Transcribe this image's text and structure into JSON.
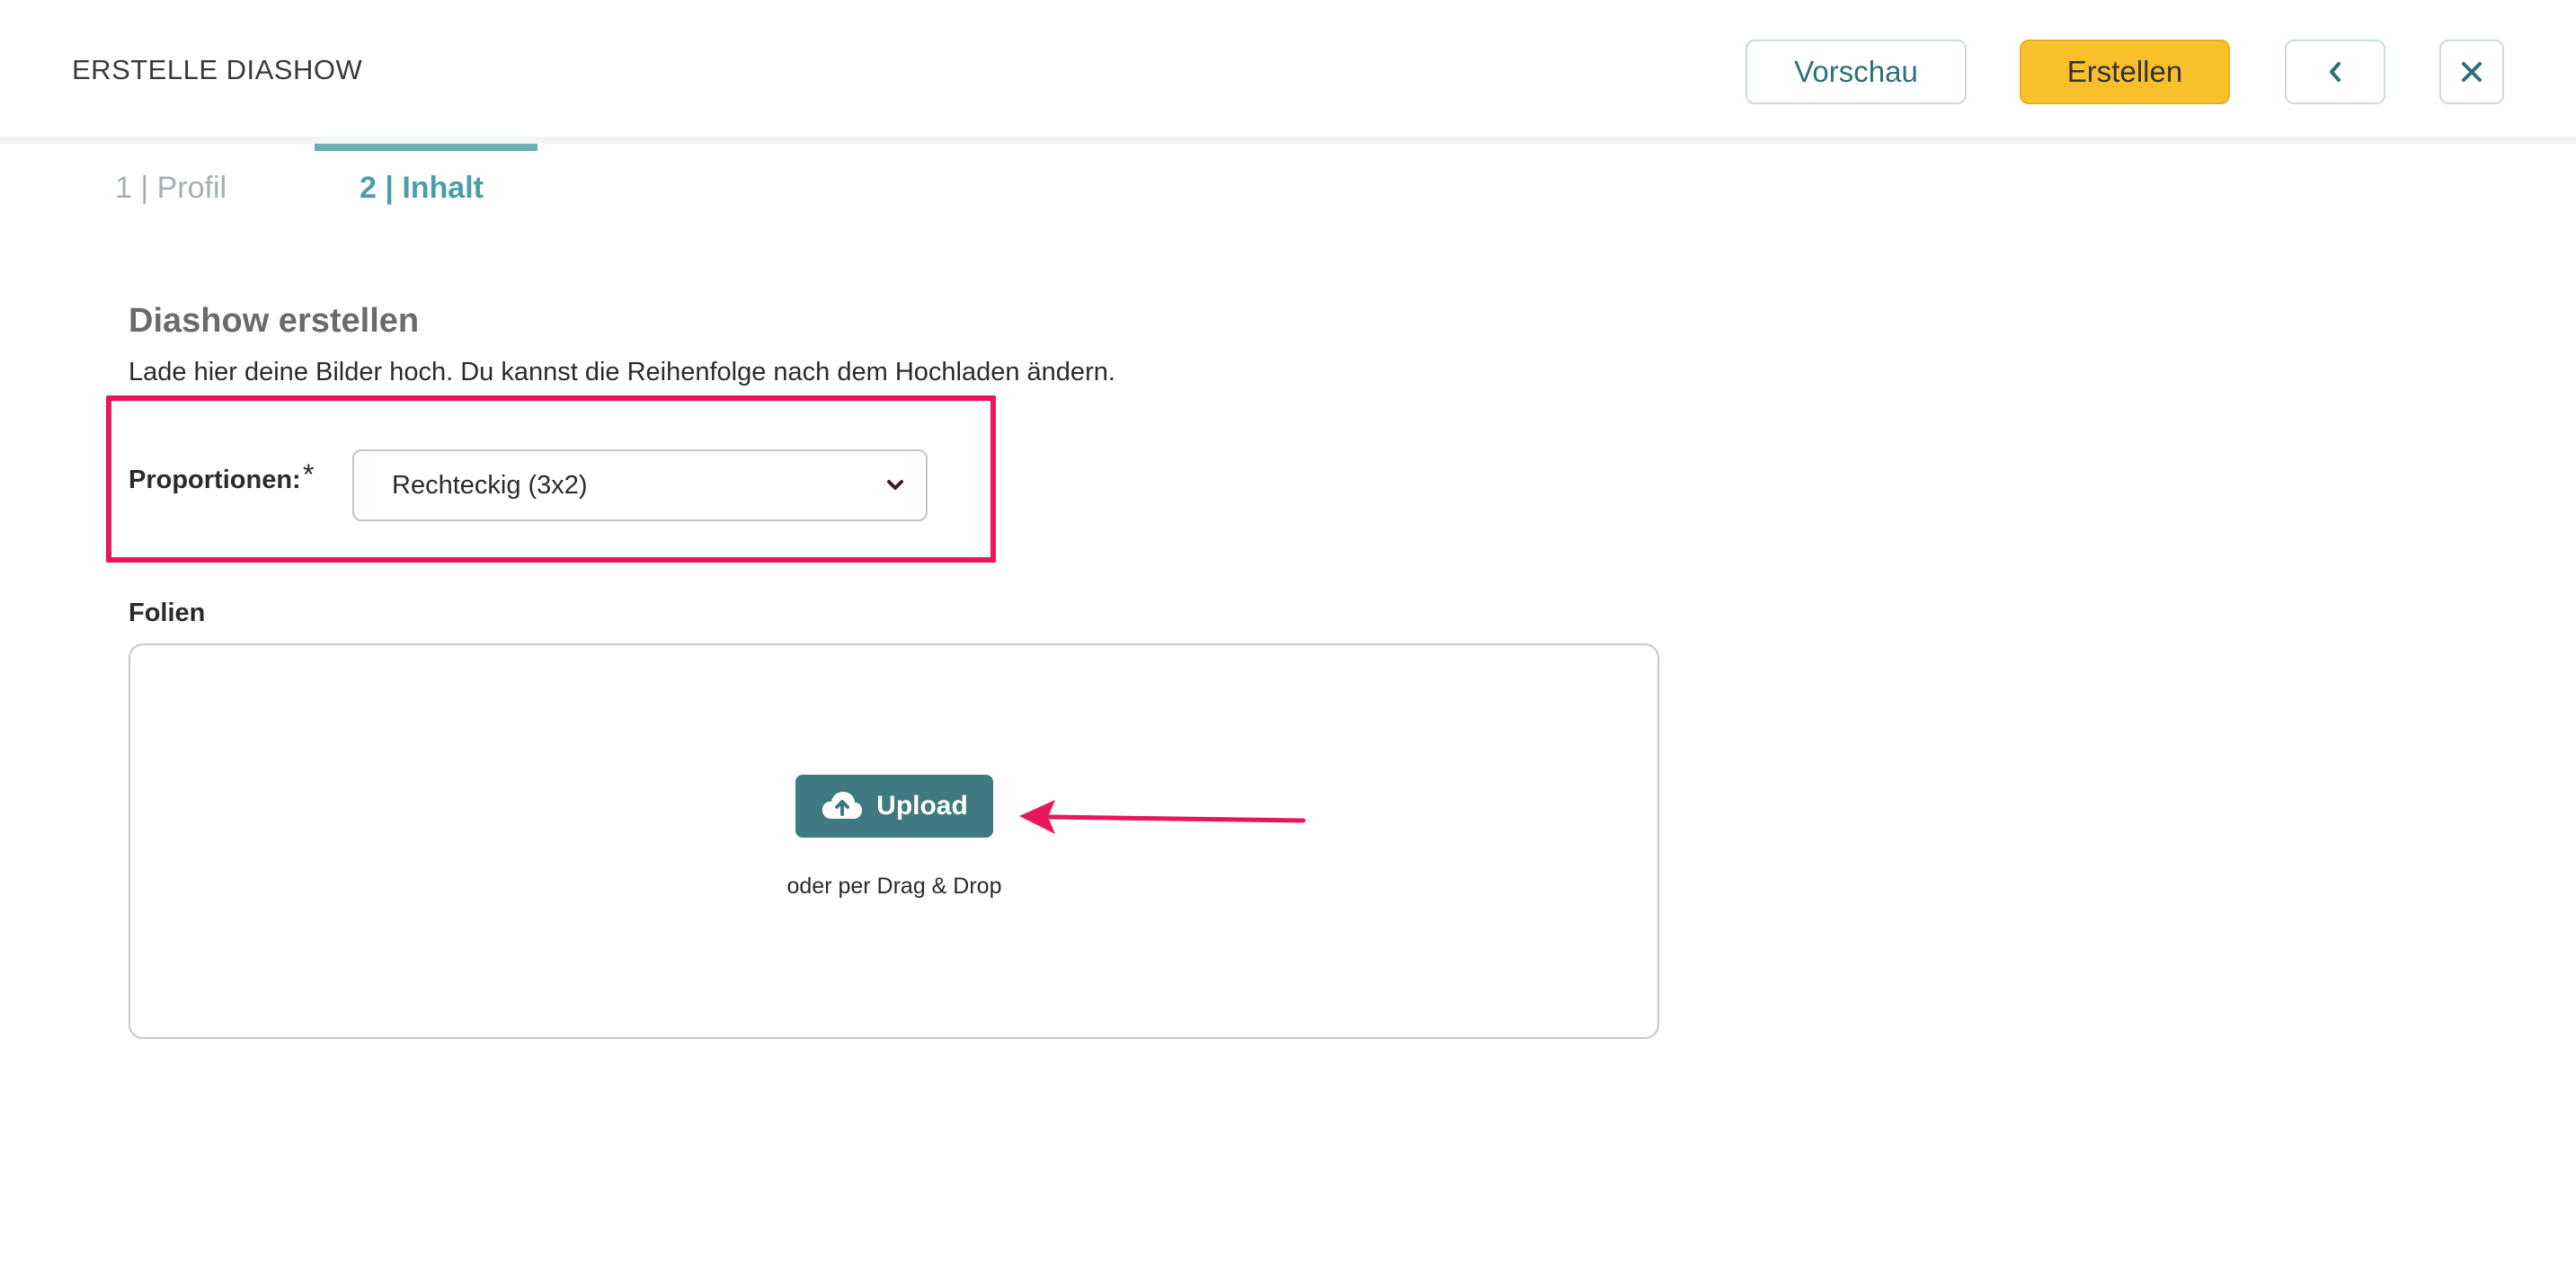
{
  "header": {
    "title": "ERSTELLE DIASHOW",
    "preview_label": "Vorschau",
    "create_label": "Erstellen"
  },
  "tabs": [
    {
      "label": "1 | Profil",
      "active": false
    },
    {
      "label": "2 | Inhalt",
      "active": true
    }
  ],
  "content": {
    "section_title": "Diashow erstellen",
    "intro": "Lade hier deine Bilder hoch. Du kannst die Reihenfolge nach dem Hochladen ändern.",
    "proportions_label": "Proportionen:",
    "required_mark": "*",
    "proportions_value": "Rechteckig (3x2)",
    "slides_label": "Folien",
    "upload_label": "Upload",
    "dnd_text": "oder per Drag & Drop"
  },
  "colors": {
    "accent_teal": "#4a9ea8",
    "upload_button": "#3f7a80",
    "create_button": "#f9c02c",
    "annotation": "#e8175d"
  },
  "icons": {
    "back": "chevron-left-icon",
    "close": "close-icon",
    "select": "chevron-down-icon",
    "upload": "cloud-upload-icon"
  }
}
